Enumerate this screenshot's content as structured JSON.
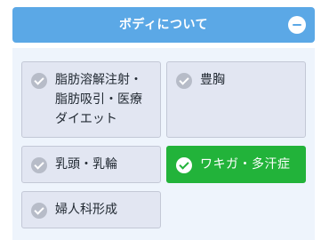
{
  "section": {
    "title": "ボディについて",
    "toggle_icon": "minus-circle-icon"
  },
  "options": [
    {
      "label": "脂肪溶解注射・\n脂肪吸引・医療\nダイエット",
      "selected": false,
      "icon": "check-circle-icon"
    },
    {
      "label": "豊胸",
      "selected": false,
      "icon": "check-circle-icon"
    },
    {
      "label": "乳頭・乳輪",
      "selected": false,
      "icon": "check-circle-icon"
    },
    {
      "label": "ワキガ・多汗症",
      "selected": true,
      "icon": "check-circle-icon"
    },
    {
      "label": "婦人科形成",
      "selected": false,
      "icon": "check-circle-icon"
    }
  ],
  "colors": {
    "header": "#5ba8e6",
    "selected": "#22b33a",
    "option_bg": "#e2e6f2",
    "body_bg": "#eef4fc"
  }
}
